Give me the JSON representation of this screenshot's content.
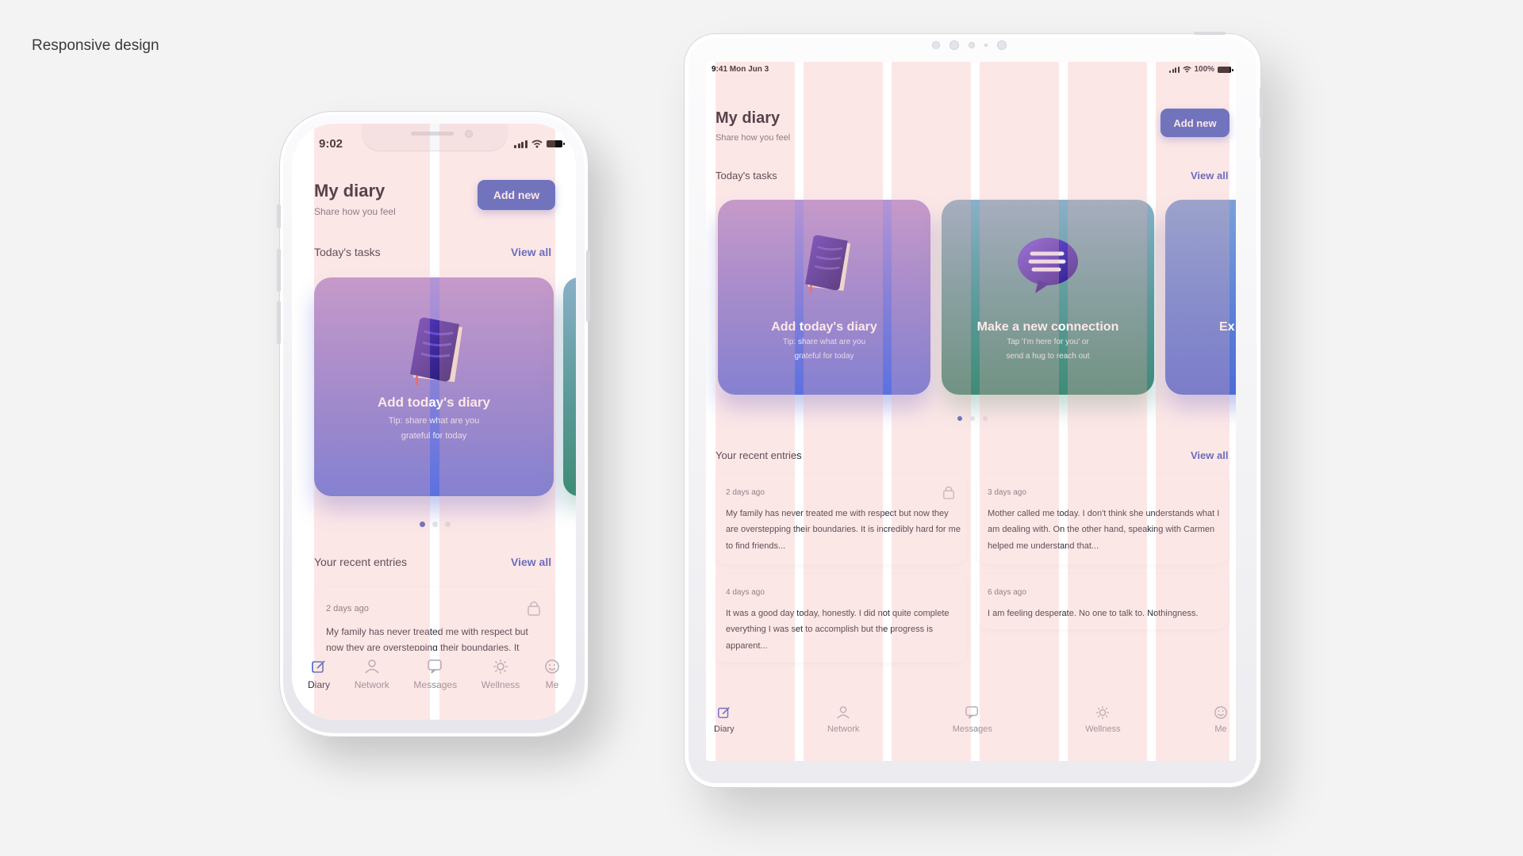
{
  "page_label": "Responsive design",
  "phone": {
    "status_time": "9:02",
    "title": "My diary",
    "subtitle": "Share how you feel",
    "add_button": "Add new",
    "tasks_label": "Today's tasks",
    "tasks_view_all": "View all",
    "task_card": {
      "title": "Add today's diary",
      "tip_line1": "Tip: share what are you",
      "tip_line2": "grateful for today"
    },
    "entries_label": "Your recent entries",
    "entries_view_all": "View all",
    "entry": {
      "date": "2 days ago",
      "text_line1": "My family has never treated me with respect but",
      "text_line2": "now they are overstepping their boundaries. It"
    },
    "tabs": [
      {
        "label": "Diary",
        "icon": "edit-icon"
      },
      {
        "label": "Network",
        "icon": "people-icon"
      },
      {
        "label": "Messages",
        "icon": "chat-icon"
      },
      {
        "label": "Wellness",
        "icon": "sun-icon"
      },
      {
        "label": "Me",
        "icon": "smile-icon"
      }
    ]
  },
  "tablet": {
    "status_time": "9:41 Mon Jun 3",
    "battery_text": "100%",
    "title": "My diary",
    "subtitle": "Share how you feel",
    "add_button": "Add new",
    "tasks_label": "Today's tasks",
    "tasks_view_all": "View all",
    "cards": [
      {
        "title": "Add today's diary",
        "tip_line1": "Tip: share what are you",
        "tip_line2": "grateful for today",
        "icon": "book-icon"
      },
      {
        "title": "Make a new connection",
        "tip_line1": "Tap 'I'm here for you' or",
        "tip_line2": "send a hug to reach out",
        "icon": "speech-bubble-icon"
      },
      {
        "title": "Ex",
        "tip_line1": "",
        "tip_line2": "",
        "icon": ""
      }
    ],
    "entries_label": "Your recent entries",
    "entries_view_all": "View all",
    "entries": [
      {
        "date": "2 days ago",
        "text": "My family has never treated me with respect but now they are overstepping their boundaries. It is incredibly hard for me to find friends...",
        "locked": true
      },
      {
        "date": "3 days ago",
        "text": "Mother called me today. I don't think she understands what I am dealing with. On the other hand, speaking with Carmen helped me understand that...",
        "locked": false
      },
      {
        "date": "4 days ago",
        "text": "It was a good day today, honestly. I did not quite complete everything I was set to accomplish but the progress is apparent...",
        "locked": false
      },
      {
        "date": "6 days ago",
        "text": "I am feeling desperate. No one to talk to. Nothingness.",
        "locked": false
      }
    ],
    "tabs": [
      {
        "label": "Diary",
        "icon": "edit-icon"
      },
      {
        "label": "Network",
        "icon": "people-icon"
      },
      {
        "label": "Messages",
        "icon": "chat-icon"
      },
      {
        "label": "Wellness",
        "icon": "sun-icon"
      },
      {
        "label": "Me",
        "icon": "smile-icon"
      }
    ]
  },
  "colors": {
    "accent": "#3f5fc4",
    "link": "#3557c4",
    "grid_overlay": "#f4aaaa"
  }
}
